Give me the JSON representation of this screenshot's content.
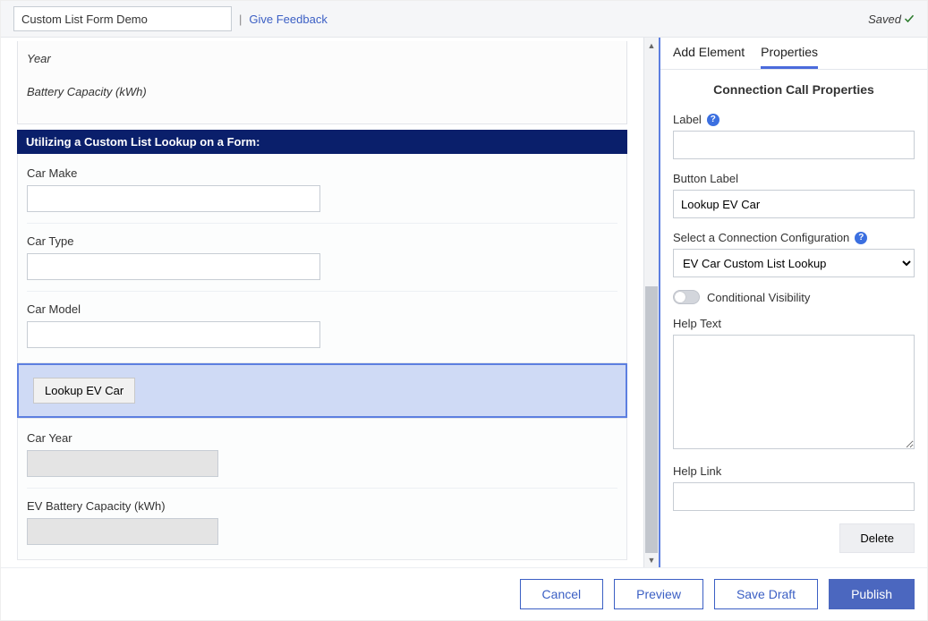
{
  "header": {
    "title_value": "Custom List Form Demo",
    "feedback_label": "Give Feedback",
    "saved_label": "Saved"
  },
  "canvas": {
    "ghost_fields": [
      "Year",
      "Battery Capacity (kWh)"
    ],
    "section_header": "Utilizing a Custom List Lookup on a Form:",
    "fields": {
      "car_make": "Car Make",
      "car_type": "Car Type",
      "car_model": "Car Model",
      "car_year": "Car Year",
      "ev_battery": "EV Battery Capacity (kWh)"
    },
    "lookup_button_label": "Lookup EV Car"
  },
  "panel": {
    "tabs": {
      "add_element": "Add Element",
      "properties": "Properties"
    },
    "title": "Connection Call Properties",
    "labels": {
      "label": "Label",
      "button_label": "Button Label",
      "select_config": "Select a Connection Configuration",
      "conditional_visibility": "Conditional Visibility",
      "help_text": "Help Text",
      "help_link": "Help Link"
    },
    "values": {
      "label": "",
      "button_label": "Lookup EV Car",
      "selected_config": "EV Car Custom List Lookup",
      "help_text": "",
      "help_link": ""
    },
    "delete_label": "Delete"
  },
  "footer": {
    "cancel": "Cancel",
    "preview": "Preview",
    "save_draft": "Save Draft",
    "publish": "Publish"
  }
}
